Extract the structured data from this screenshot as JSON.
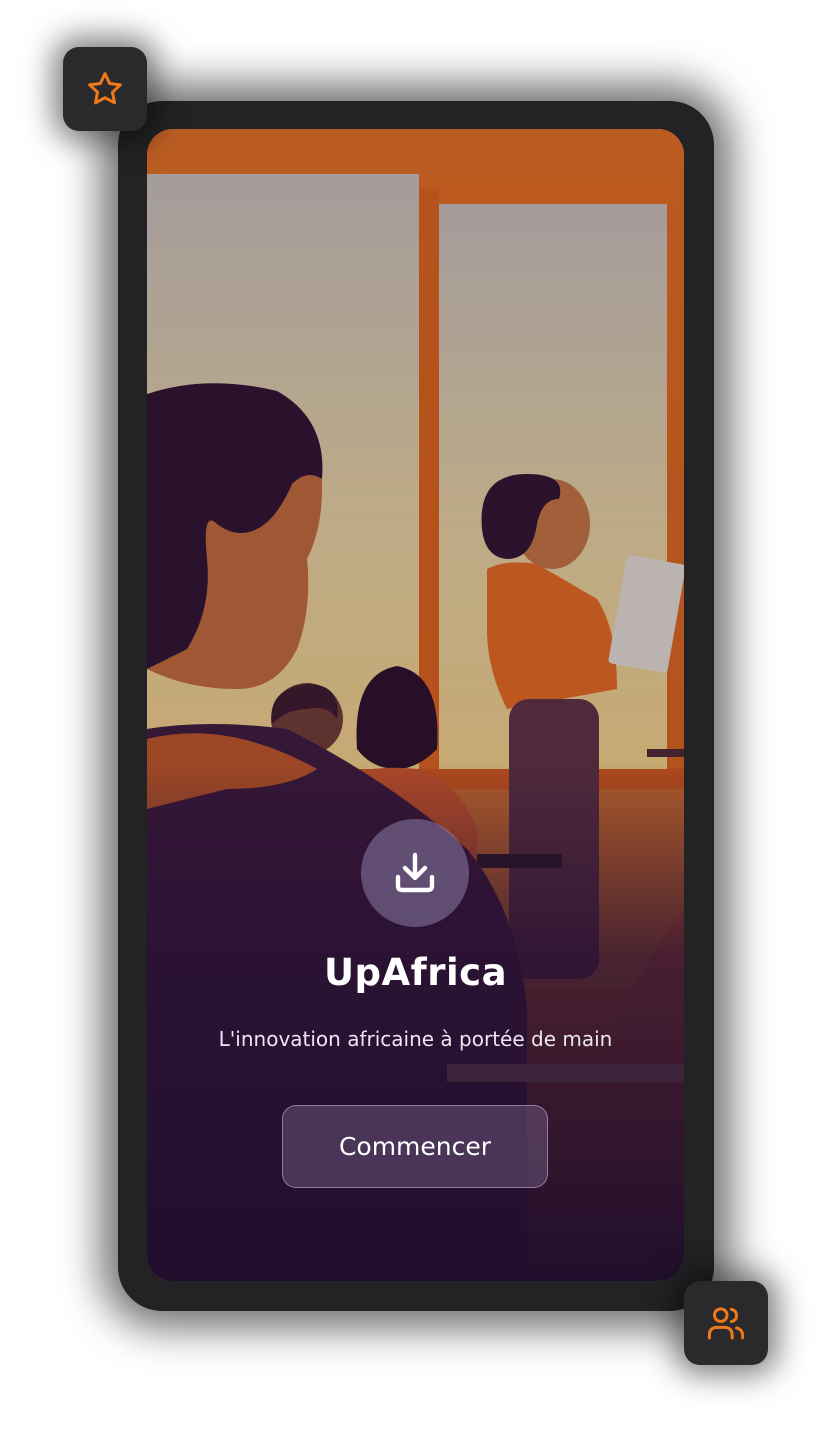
{
  "app": {
    "title": "UpAfrica",
    "tagline": "L'innovation africaine à portée de main",
    "cta_label": "Commencer"
  },
  "icons": {
    "top_left_badge": "star-icon",
    "bottom_right_badge": "users-icon",
    "hero_badge": "download-icon"
  },
  "colors": {
    "accent": "#F07A1A",
    "frame": "#232325",
    "overlay_dark": "#2a1236",
    "text_primary": "#FFFFFF"
  }
}
